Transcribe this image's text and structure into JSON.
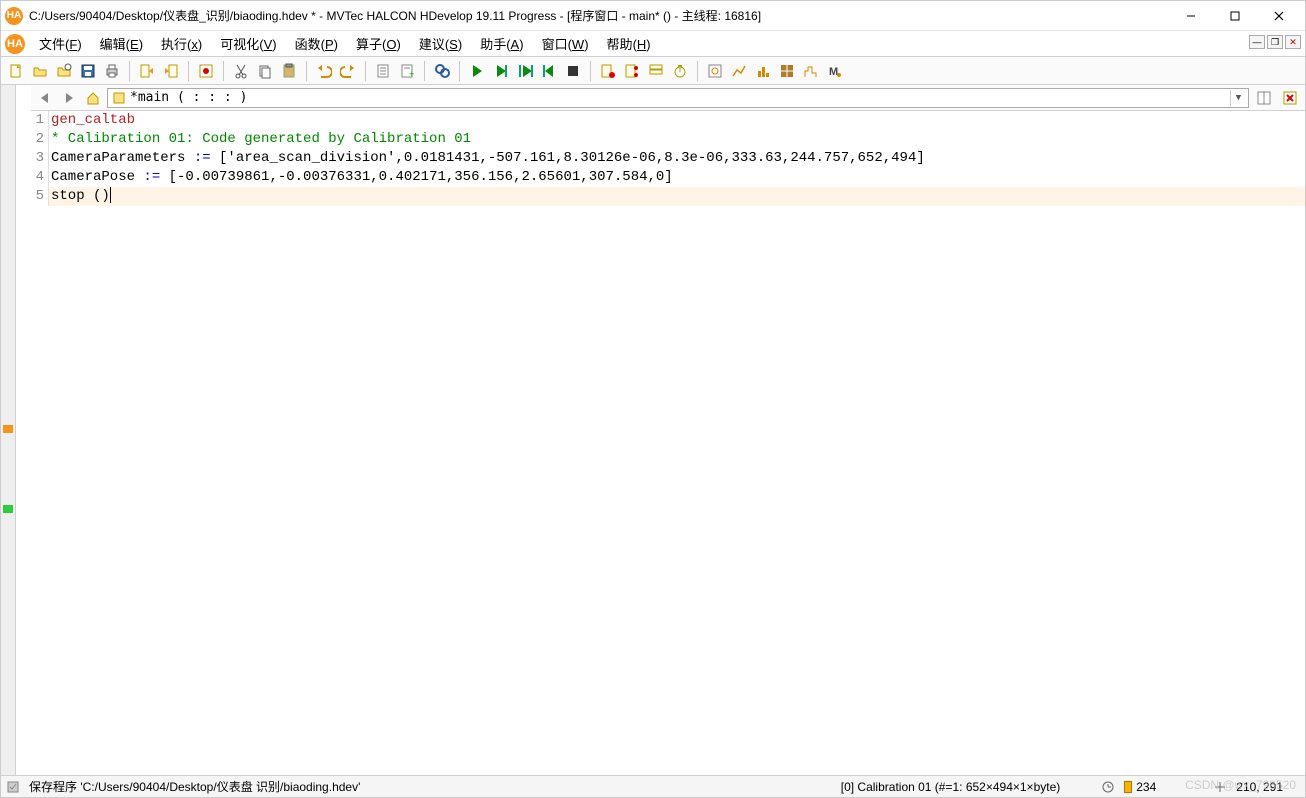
{
  "titlebar": {
    "title": "C:/Users/90404/Desktop/仪表盘_识别/biaoding.hdev * - MVTec HALCON HDevelop 19.11 Progress - [程序窗口 - main* () - 主线程: 16816]"
  },
  "menu": {
    "file": {
      "label": "文件",
      "key": "F"
    },
    "edit": {
      "label": "编辑",
      "key": "E"
    },
    "execute": {
      "label": "执行",
      "key": "x"
    },
    "vis": {
      "label": "可视化",
      "key": "V"
    },
    "func": {
      "label": "函数",
      "key": "P"
    },
    "oper": {
      "label": "算子",
      "key": "O"
    },
    "suggest": {
      "label": "建议",
      "key": "S"
    },
    "assist": {
      "label": "助手",
      "key": "A"
    },
    "window": {
      "label": "窗口",
      "key": "W"
    },
    "help": {
      "label": "帮助",
      "key": "H"
    }
  },
  "procbar": {
    "combo": "*main ( : : : )"
  },
  "code": {
    "lines": [
      {
        "n": "1",
        "type": "func",
        "text": "gen_caltab"
      },
      {
        "n": "2",
        "type": "comment",
        "text": "* Calibration 01: Code generated by Calibration 01"
      },
      {
        "n": "3",
        "type": "assign",
        "var": "CameraParameters",
        "op": " := ",
        "val": "['area_scan_division',0.0181431,-507.161,8.30126e-06,8.3e-06,333.63,244.757,652,494]",
        "pc": true
      },
      {
        "n": "4",
        "type": "assign",
        "var": "CameraPose",
        "op": " := ",
        "val": "[-0.00739861,-0.00376331,0.402171,356.156,2.65601,307.584,0]"
      },
      {
        "n": "5",
        "type": "stop",
        "text": "stop ()",
        "bp": true,
        "hl": true
      }
    ]
  },
  "status": {
    "msg": "保存程序 'C:/Users/90404/Desktop/仪表盘 识别/biaoding.hdev'",
    "info": "[0] Calibration 01 (#=1: 652×494×1×byte)",
    "mem": "234",
    "cursor": "210, 291"
  },
  "watermark": "CSDN @wx_798520"
}
